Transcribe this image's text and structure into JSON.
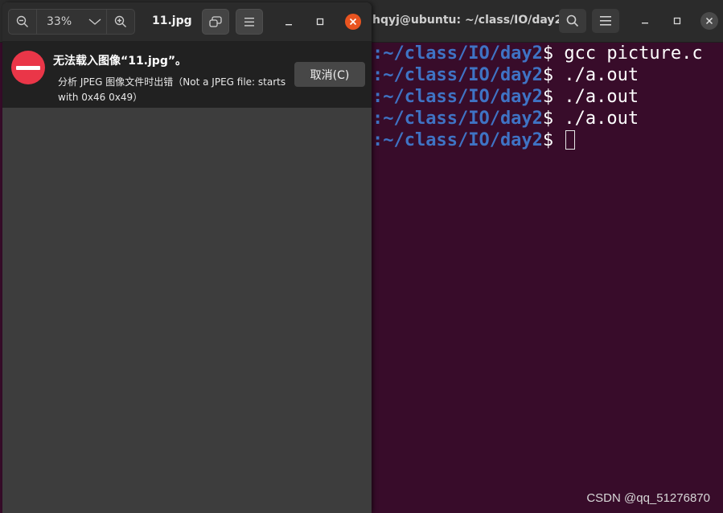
{
  "terminal": {
    "title": "hqyj@ubuntu: ~/class/IO/day2",
    "lines": [
      {
        "path": ":~/class/IO/day2",
        "prompt": "$",
        "command": " gcc picture.c"
      },
      {
        "path": ":~/class/IO/day2",
        "prompt": "$",
        "command": " ./a.out"
      },
      {
        "path": ":~/class/IO/day2",
        "prompt": "$",
        "command": " ./a.out"
      },
      {
        "path": ":~/class/IO/day2",
        "prompt": "$",
        "command": " ./a.out"
      },
      {
        "path": ":~/class/IO/day2",
        "prompt": "$",
        "command": " "
      }
    ],
    "colors": {
      "background": "#380c2a",
      "path": "#3f73c4",
      "text": "#ffffff"
    }
  },
  "viewer": {
    "zoom": "33%",
    "title": "11.jpg",
    "error": {
      "title": "无法载入图像“11.jpg”。",
      "detail": "分析 JPEG 图像文件时出错（Not a JPEG file: starts with 0x46 0x49）",
      "cancel_label": "取消(C)"
    },
    "colors": {
      "close": "#e95420",
      "error_icon": "#ea3648"
    }
  },
  "watermark": "CSDN @qq_51276870",
  "icons": [
    "zoom-out-icon",
    "chevron-down-icon",
    "zoom-in-icon",
    "restore-icon",
    "menu-icon",
    "minimize-icon",
    "maximize-icon",
    "close-icon",
    "search-icon",
    "error-icon"
  ]
}
